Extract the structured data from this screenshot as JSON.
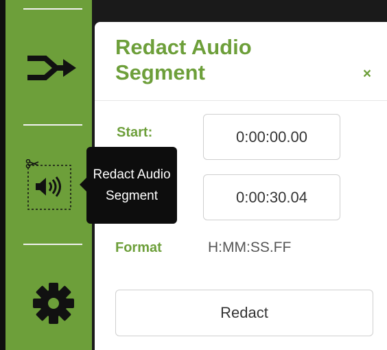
{
  "theme": {
    "accent": "#6d9f3a",
    "sidebar_bg": "#6d9f3a",
    "panel_bg": "#ffffff",
    "tooltip_bg": "#0d0d0d"
  },
  "sidebar": {
    "items": [
      {
        "icon": "merge-arrow-icon",
        "selected": false
      },
      {
        "icon": "redact-audio-icon",
        "selected": true
      },
      {
        "icon": "gear-icon",
        "selected": false
      }
    ]
  },
  "tooltip": {
    "text": "Redact Audio Segment"
  },
  "panel": {
    "title": "Redact Audio Segment",
    "close_label": "×",
    "start_label": "Start:",
    "start_value": "0:00:00.00",
    "end_value": "0:00:30.04",
    "format_label": "Format",
    "format_value": "H:MM:SS.FF",
    "redact_label": "Redact"
  }
}
